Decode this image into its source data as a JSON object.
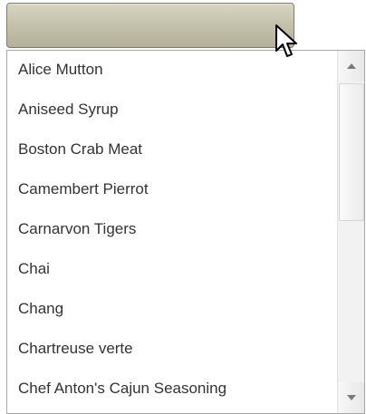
{
  "dropdown": {
    "selected_value": "",
    "options": [
      "Alice Mutton",
      "Aniseed Syrup",
      "Boston Crab Meat",
      "Camembert Pierrot",
      "Carnarvon Tigers",
      "Chai",
      "Chang",
      "Chartreuse verte",
      "Chef Anton's Cajun Seasoning"
    ]
  },
  "icons": {
    "cursor": "mouse-pointer-icon",
    "scroll_up": "arrow-up-icon",
    "scroll_down": "arrow-down-icon"
  },
  "colors": {
    "header_bg": "#c6c3ad",
    "header_border": "#7d7b69",
    "list_text": "#333333",
    "list_border": "#a7a7a7"
  }
}
